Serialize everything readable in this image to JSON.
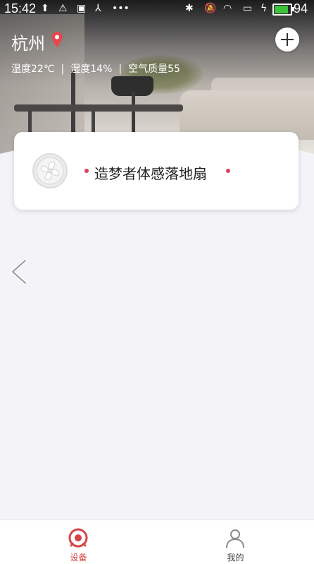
{
  "status_bar": {
    "time": "15:42",
    "battery_level": "94",
    "battery_fraction": 0.94,
    "icons": [
      "upload-icon",
      "warning-icon",
      "image-icon",
      "usb-icon",
      "more-dots-icon",
      "bluetooth-icon",
      "mute-icon",
      "wifi-icon",
      "screen-icon",
      "charging-icon"
    ]
  },
  "header": {
    "city": "杭州",
    "weather": {
      "temperature": "温度22℃",
      "humidity": "湿度14%",
      "air_quality": "空气质量55",
      "separator": "|"
    }
  },
  "device_card": {
    "name": "造梦者体感落地扇",
    "status_dot_color": "#e0405a"
  },
  "bottom_nav": {
    "items": [
      {
        "label": "设备",
        "active": true,
        "icon": "device-icon",
        "color": "#d84545"
      },
      {
        "label": "我的",
        "active": false,
        "icon": "person-icon",
        "color": "#444444"
      }
    ]
  },
  "colors": {
    "accent": "#d84545",
    "page_background": "#f4f3f7",
    "battery_green": "#3cc43c"
  }
}
